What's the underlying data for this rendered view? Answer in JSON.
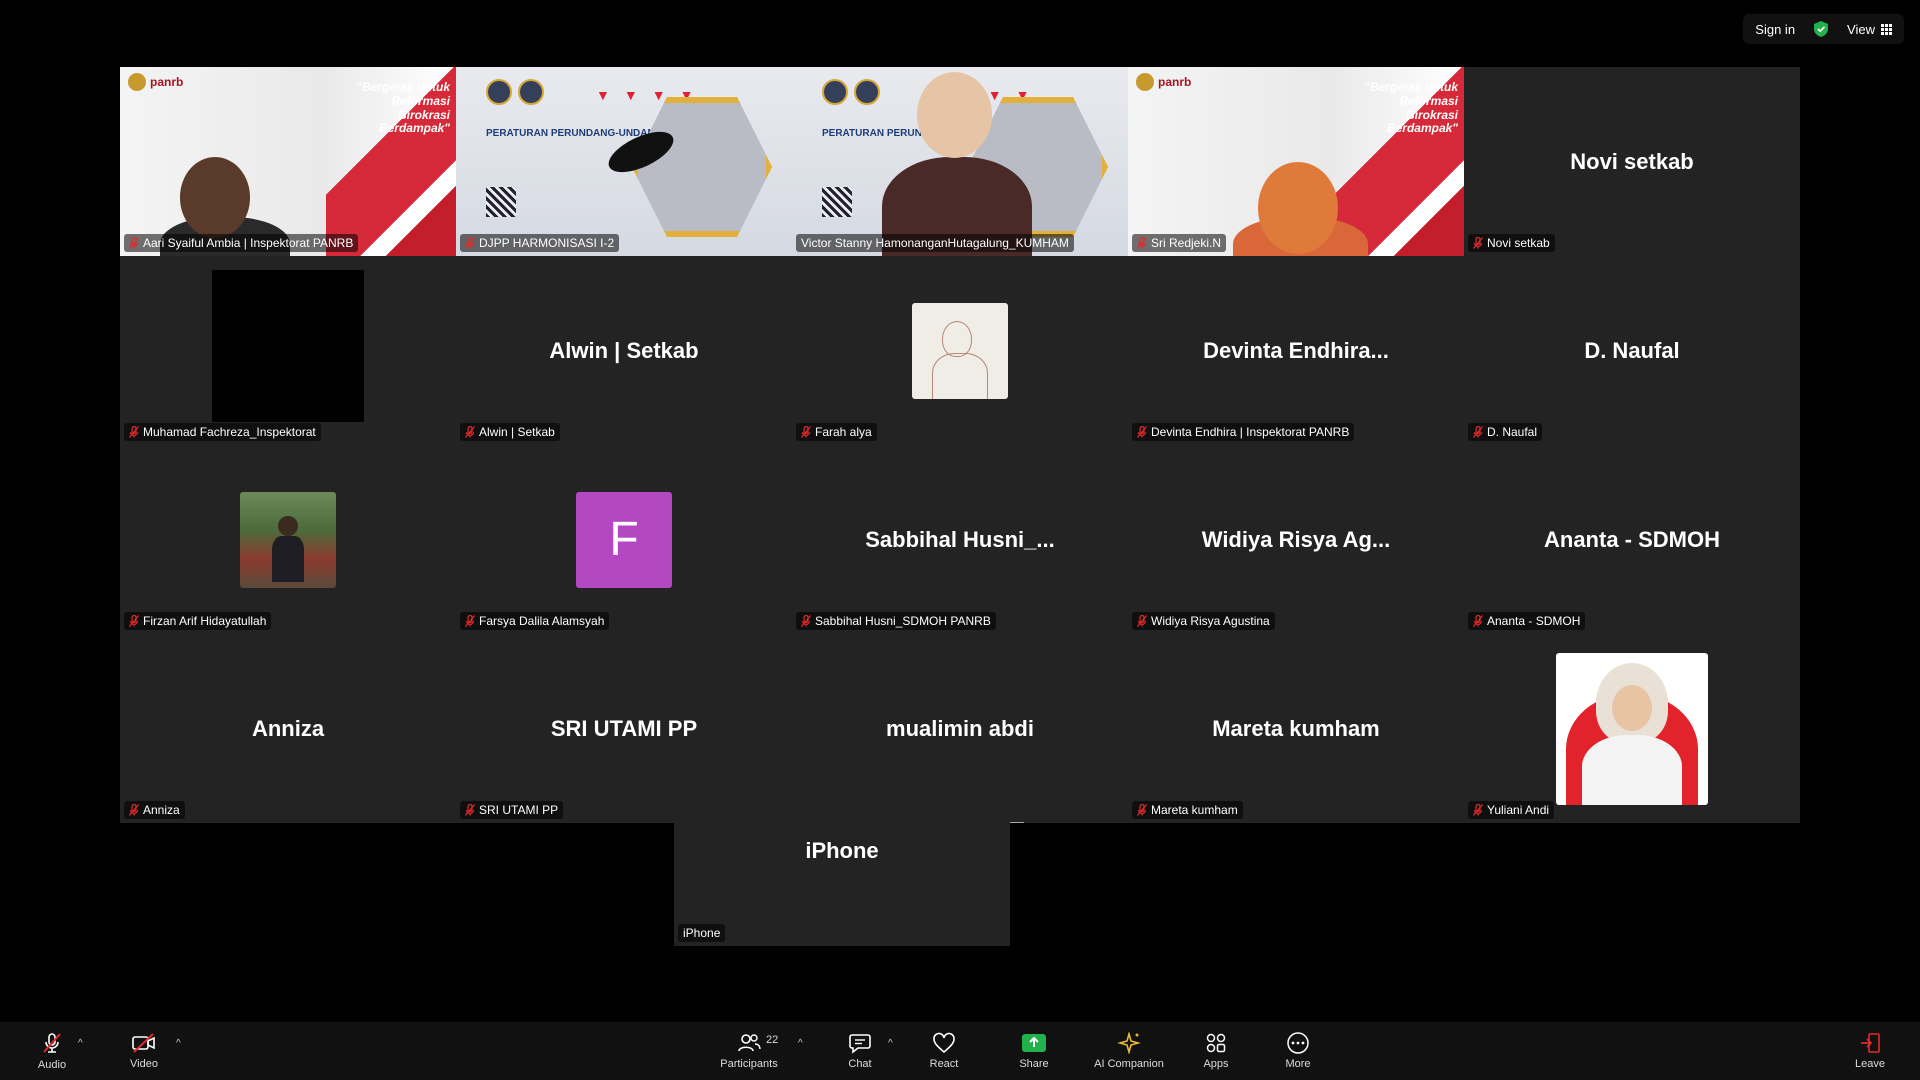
{
  "topbar": {
    "sign_in": "Sign in",
    "view": "View"
  },
  "tiles": [
    {
      "id": "t1",
      "big": "",
      "tag": "Aari Syaiful Ambia | Inspektorat PANRB",
      "muted": true,
      "kind": "panrb-man"
    },
    {
      "id": "t2",
      "big": "",
      "tag": "DJPP HARMONISASI I-2",
      "muted": true,
      "kind": "djpp"
    },
    {
      "id": "t3",
      "big": "",
      "tag": "Victor Stanny HamonanganHutagalung_KUMHAM",
      "muted": false,
      "kind": "djpp-man",
      "active": true
    },
    {
      "id": "t4",
      "big": "",
      "tag": "Sri Redjeki.N",
      "muted": true,
      "kind": "panrb-woman"
    },
    {
      "id": "t5",
      "big": "Novi setkab",
      "tag": "Novi setkab",
      "muted": true
    },
    {
      "id": "t6",
      "big": "",
      "tag": "Muhamad Fachreza_Inspektorat",
      "muted": true,
      "kind": "black"
    },
    {
      "id": "t7",
      "big": "Alwin | Setkab",
      "tag": "Alwin | Setkab",
      "muted": true
    },
    {
      "id": "t8",
      "big": "",
      "tag": "Farah alya",
      "muted": true,
      "kind": "sketch"
    },
    {
      "id": "t9",
      "big": "Devinta  Endhira...",
      "tag": "Devinta Endhira | Inspektorat PANRB",
      "muted": true
    },
    {
      "id": "t10",
      "big": "D. Naufal",
      "tag": "D. Naufal",
      "muted": true
    },
    {
      "id": "t11",
      "big": "",
      "tag": "Firzan Arif Hidayatullah",
      "muted": true,
      "kind": "photo"
    },
    {
      "id": "t12",
      "big": "",
      "tag": "Farsya Dalila Alamsyah",
      "muted": true,
      "kind": "letter",
      "letter": "F"
    },
    {
      "id": "t13",
      "big": "Sabbihal  Husni_...",
      "tag": "Sabbihal Husni_SDMOH PANRB",
      "muted": true
    },
    {
      "id": "t14",
      "big": "Widiya  Risya  Ag...",
      "tag": "Widiya Risya Agustina",
      "muted": true
    },
    {
      "id": "t15",
      "big": "Ananta - SDMOH",
      "tag": "Ananta - SDMOH",
      "muted": true
    },
    {
      "id": "t16",
      "big": "Anniza",
      "tag": "Anniza",
      "muted": true
    },
    {
      "id": "t17",
      "big": "SRI UTAMI PP",
      "tag": "SRI UTAMI PP",
      "muted": true
    },
    {
      "id": "t18",
      "big": "mualimin abdi",
      "tag": "mualimin abdi",
      "muted": false
    },
    {
      "id": "t19",
      "big": "Mareta kumham",
      "tag": "Mareta kumham",
      "muted": true
    },
    {
      "id": "t20",
      "big": "",
      "tag": "Yuliani Andi",
      "muted": true,
      "kind": "hijab"
    }
  ],
  "iphone": {
    "big": "iPhone",
    "tag": "iPhone"
  },
  "slide": {
    "panrb_logo": "panrb",
    "quote": "\"Bergerak untuk Reformasi Birokrasi Berdampak\"",
    "djpp_title": "PERATURAN PERUNDANG-UNDANGAN"
  },
  "toolbar": {
    "audio": "Audio",
    "video": "Video",
    "participants": "Participants",
    "participants_count": "22",
    "chat": "Chat",
    "react": "React",
    "share": "Share",
    "ai": "AI Companion",
    "apps": "Apps",
    "more": "More",
    "leave": "Leave"
  },
  "colors": {
    "active_border": "#2ecc71",
    "share_green": "#22b14c",
    "leave_red": "#e02b2b",
    "avatar_purple": "#b447c2"
  }
}
